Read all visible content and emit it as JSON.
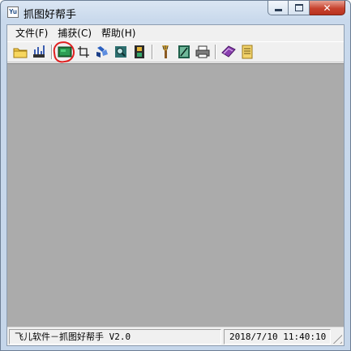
{
  "window": {
    "title": "抓图好帮手",
    "icon_label": "Yu",
    "caption_buttons": {
      "close_label": "✕"
    }
  },
  "menu": [
    {
      "label": "文件(F)"
    },
    {
      "label": "捕获(C)"
    },
    {
      "label": "帮助(H)"
    }
  ],
  "toolbar": {
    "buttons": [
      {
        "icon": "open-folder-icon"
      },
      {
        "icon": "save-disk-icon"
      },
      {
        "icon": "capture-screen-icon",
        "highlighted": true
      },
      {
        "icon": "capture-region-icon"
      },
      {
        "icon": "capture-object-icon"
      },
      {
        "icon": "zoom-preview-icon"
      },
      {
        "icon": "film-capture-icon"
      },
      {
        "icon": "paint-brush-icon"
      },
      {
        "icon": "edit-image-icon"
      },
      {
        "icon": "print-icon"
      },
      {
        "icon": "help-book-icon"
      },
      {
        "icon": "notes-icon"
      }
    ]
  },
  "status": {
    "app_text": "飞儿软件－抓图好帮手  V2.0",
    "datetime": "2018/7/10 11:40:10"
  },
  "colors": {
    "workspace": "#ababab",
    "annotation": "#e02020"
  }
}
